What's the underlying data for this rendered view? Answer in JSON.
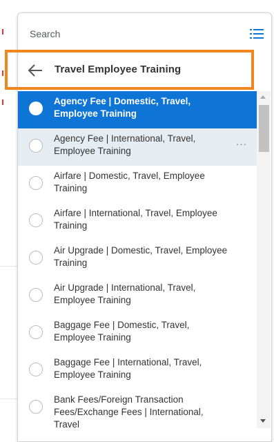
{
  "search": {
    "placeholder": "Search"
  },
  "header": {
    "back_title": "Travel Employee Training"
  },
  "items": [
    {
      "label": "Agency Fee | Domestic, Travel, Employee Training",
      "state": "selected"
    },
    {
      "label": "Agency Fee | International, Travel, Employee Training",
      "state": "hover",
      "more": "···"
    },
    {
      "label": "Airfare | Domestic, Travel, Employee Training",
      "state": "normal"
    },
    {
      "label": "Airfare | International, Travel, Employee Training",
      "state": "normal"
    },
    {
      "label": "Air Upgrade | Domestic, Travel, Employee Training",
      "state": "normal"
    },
    {
      "label": "Air Upgrade | International, Travel, Employee Training",
      "state": "normal"
    },
    {
      "label": "Baggage Fee | Domestic, Travel, Employee Training",
      "state": "normal"
    },
    {
      "label": "Baggage Fee | International, Travel, Employee Training",
      "state": "normal"
    },
    {
      "label": "Bank Fees/Foreign Transaction Fees/Exchange Fees | International, Travel",
      "state": "normal"
    }
  ],
  "colors": {
    "selected": "#0e74d6",
    "hover": "#e5ecf2",
    "highlight": "#f0861e",
    "accent": "#0e74d6"
  },
  "icons": {
    "list": "list-icon",
    "back": "back-arrow-icon"
  }
}
